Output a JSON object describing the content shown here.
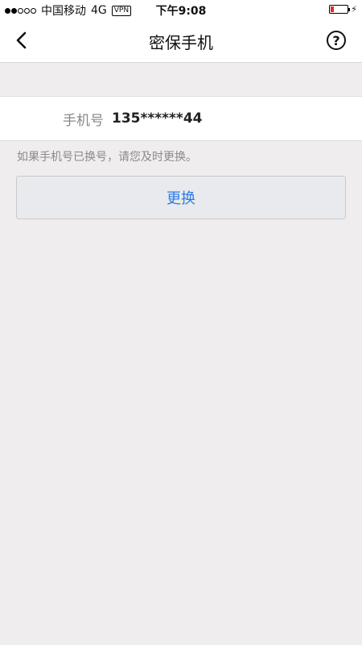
{
  "status_bar": {
    "carrier": "中国移动",
    "network": "4G",
    "vpn": "VPN",
    "time": "下午9:08",
    "battery_level": 0.2,
    "battery_color": "#e12b2b"
  },
  "nav": {
    "title": "密保手机",
    "back_icon": "chevron-left-icon",
    "help_icon": "question-circle-icon"
  },
  "phone": {
    "label": "手机号",
    "value": "135******44"
  },
  "hint": "如果手机号已换号，请您及时更换。",
  "change_button": {
    "label": "更换",
    "color": "#2a7be4"
  }
}
